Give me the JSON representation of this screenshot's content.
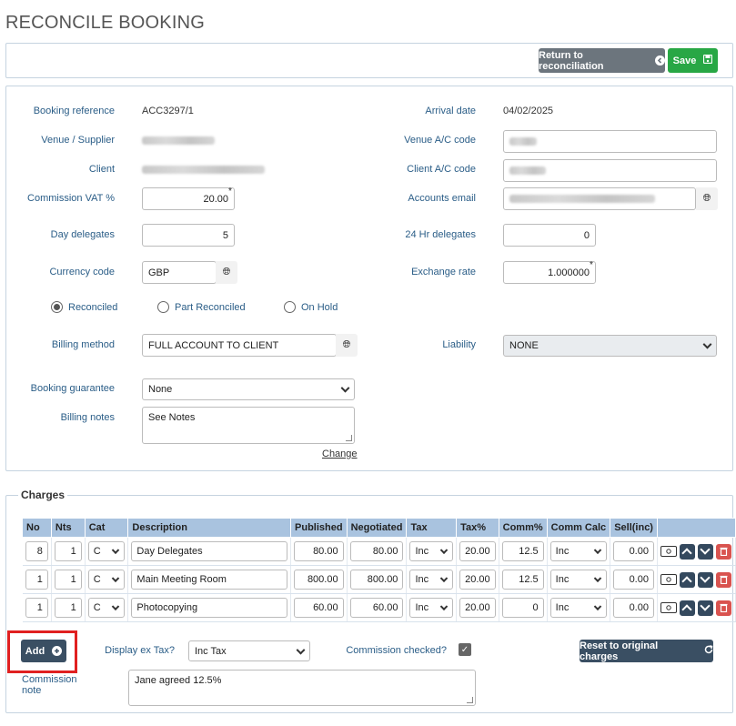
{
  "page": {
    "title": "RECONCILE BOOKING"
  },
  "toolbar": {
    "return_label": "Return to reconciliation",
    "save_label": "Save"
  },
  "booking": {
    "booking_reference_label": "Booking reference",
    "booking_reference": "ACC3297/1",
    "arrival_date_label": "Arrival date",
    "arrival_date": "04/02/2025",
    "venue_label": "Venue / Supplier",
    "venue_ac_label": "Venue A/C code",
    "client_label": "Client",
    "client_ac_label": "Client A/C code",
    "commission_vat_label": "Commission VAT %",
    "commission_vat": "20.00",
    "accounts_email_label": "Accounts email",
    "day_delegates_label": "Day delegates",
    "day_delegates": "5",
    "hr24_delegates_label": "24 Hr delegates",
    "hr24_delegates": "0",
    "currency_label": "Currency code",
    "currency": "GBP",
    "exchange_rate_label": "Exchange rate",
    "exchange_rate": "1.000000",
    "status_options": [
      "Reconciled",
      "Part Reconciled",
      "On Hold"
    ],
    "status_selected": "Reconciled",
    "billing_method_label": "Billing method",
    "billing_method": "FULL ACCOUNT TO CLIENT",
    "liability_label": "Liability",
    "liability": "NONE",
    "guarantee_label": "Booking guarantee",
    "guarantee": "None",
    "billing_notes_label": "Billing notes",
    "billing_notes": "See Notes",
    "change_link": "Change"
  },
  "charges": {
    "legend": "Charges",
    "columns": [
      "No",
      "Nts",
      "Cat",
      "Description",
      "Published",
      "Negotiated",
      "Tax",
      "Tax%",
      "Comm%",
      "Comm Calc",
      "Sell(inc)"
    ],
    "rows": [
      {
        "no": "8",
        "nts": "1",
        "cat": "C",
        "description": "Day Delegates",
        "published": "80.00",
        "negotiated": "80.00",
        "tax": "Inc",
        "tax_pct": "20.00",
        "comm_pct": "12.5",
        "comm_calc": "Inc",
        "sell": "0.00"
      },
      {
        "no": "1",
        "nts": "1",
        "cat": "C",
        "description": "Main Meeting Room",
        "published": "800.00",
        "negotiated": "800.00",
        "tax": "Inc",
        "tax_pct": "20.00",
        "comm_pct": "12.5",
        "comm_calc": "Inc",
        "sell": "0.00"
      },
      {
        "no": "1",
        "nts": "1",
        "cat": "C",
        "description": "Photocopying",
        "published": "60.00",
        "negotiated": "60.00",
        "tax": "Inc",
        "tax_pct": "20.00",
        "comm_pct": "0",
        "comm_calc": "Inc",
        "sell": "0.00"
      }
    ],
    "add_label": "Add",
    "display_ex_tax_label": "Display ex Tax?",
    "display_ex_tax_value": "Inc Tax",
    "commission_checked_label": "Commission checked?",
    "commission_checked": true,
    "reset_label": "Reset to original charges",
    "commission_note_label": "Commission note",
    "commission_note": "Jane agreed 12.5%"
  },
  "icons": {
    "return": "chevron-left-circle-icon",
    "save": "floppy-disk-icon",
    "globe": "globe-icon",
    "add": "plus-circle-icon",
    "reset": "refresh-icon",
    "row_money": "money-icon",
    "row_up": "chevron-up-icon",
    "row_down": "chevron-down-icon",
    "row_delete": "trash-icon"
  },
  "colors": {
    "label": "#2a5d87",
    "header_bg": "#a9c3df",
    "green": "#28a745",
    "grey_btn": "#6c757d",
    "dark_btn": "#3a4f63",
    "delete": "#d9534f",
    "highlight": "#e02020"
  }
}
